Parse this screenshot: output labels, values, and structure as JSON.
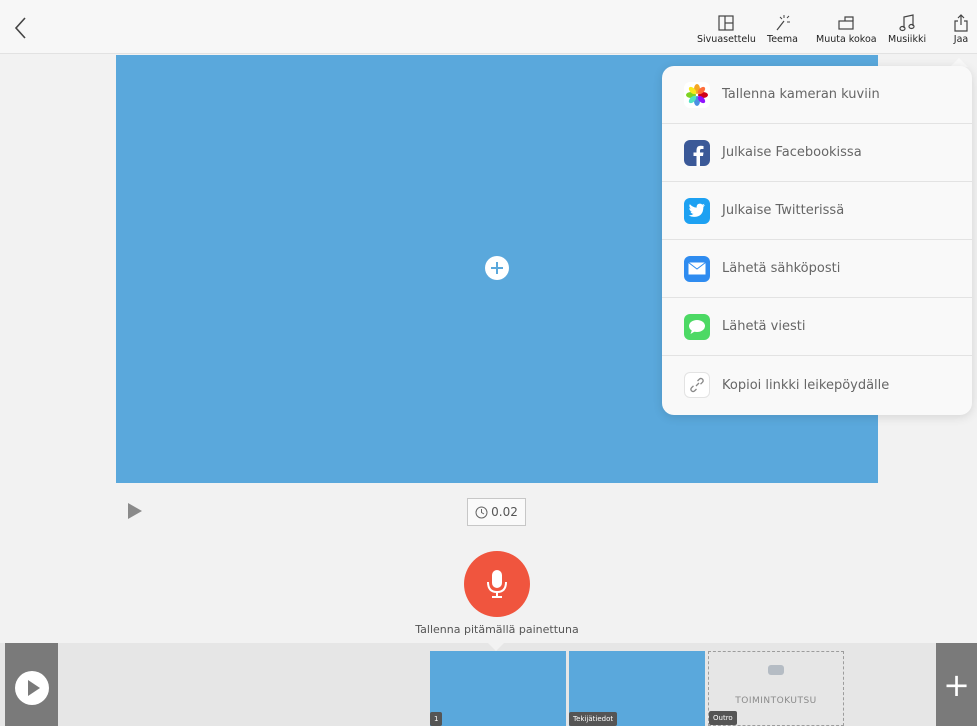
{
  "toolbar": {
    "items": [
      {
        "label": "Sivuasettelu",
        "icon": "layout-icon"
      },
      {
        "label": "Teema",
        "icon": "magic-wand-icon"
      },
      {
        "label": "Muuta kokoa",
        "icon": "resize-icon"
      },
      {
        "label": "Musiikki",
        "icon": "music-note-icon"
      },
      {
        "label": "Jaa",
        "icon": "share-icon"
      }
    ]
  },
  "player": {
    "duration": "0.02"
  },
  "record": {
    "hint": "Tallenna pitämällä painettuna"
  },
  "share_menu": {
    "items": [
      {
        "label": "Tallenna kameran kuviin",
        "icon": "photos-icon"
      },
      {
        "label": "Julkaise Facebookissa",
        "icon": "facebook-icon"
      },
      {
        "label": "Julkaise Twitterissä",
        "icon": "twitter-icon"
      },
      {
        "label": "Lähetä sähköposti",
        "icon": "mail-icon"
      },
      {
        "label": "Lähetä viesti",
        "icon": "messages-icon"
      },
      {
        "label": "Kopioi linkki leikepöydälle",
        "icon": "link-icon"
      }
    ]
  },
  "timeline": {
    "slides": [
      {
        "tag": "1"
      },
      {
        "tag": "Tekijätiedot"
      }
    ],
    "cta": {
      "label": "TOIMINTOKUTSU",
      "tag": "Outro"
    }
  },
  "colors": {
    "canvas": "#5aa8dc",
    "record": "#f0553e"
  }
}
